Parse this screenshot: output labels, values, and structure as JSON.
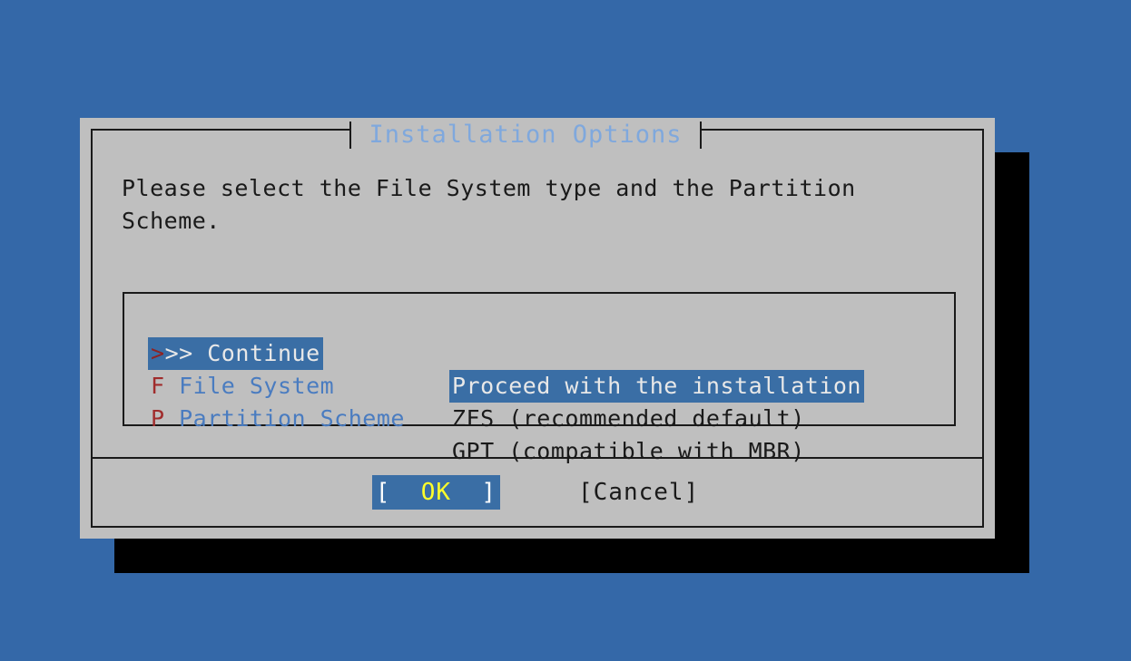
{
  "screen": {
    "background_color": "#3468a8"
  },
  "dialog": {
    "title": "Installation Options",
    "background_color": "#bfbfbf",
    "title_color": "#7fa8dd",
    "prompt": "Please select the File System type and the Partition Scheme.",
    "menu": {
      "selected_index": 0,
      "highlight_color": "#3a6ea5",
      "shortcut_color": "#a02c2c",
      "tag_color": "#4a7cc0",
      "items": [
        {
          "shortcut": ">",
          "tag_rest": ">> Continue",
          "tag_full": ">>> Continue",
          "description": "Proceed with the installation"
        },
        {
          "shortcut": "F",
          "tag_rest": " File System",
          "tag_full": "F File System",
          "description": "ZFS (recommended default)"
        },
        {
          "shortcut": "P",
          "tag_rest": " Partition Scheme",
          "tag_full": "P Partition Scheme",
          "description": "GPT (compatible with MBR)"
        }
      ]
    },
    "buttons": {
      "ok": {
        "open_bracket": "[",
        "label": "  OK  ",
        "close_bracket": "]",
        "label_color": "#ffff2a",
        "background_color": "#3a6ea5",
        "selected": "true"
      },
      "cancel": {
        "open_bracket": "[",
        "label": "Cancel",
        "close_bracket": "]",
        "label_color": "#1a1a1a",
        "selected": "false"
      }
    }
  }
}
